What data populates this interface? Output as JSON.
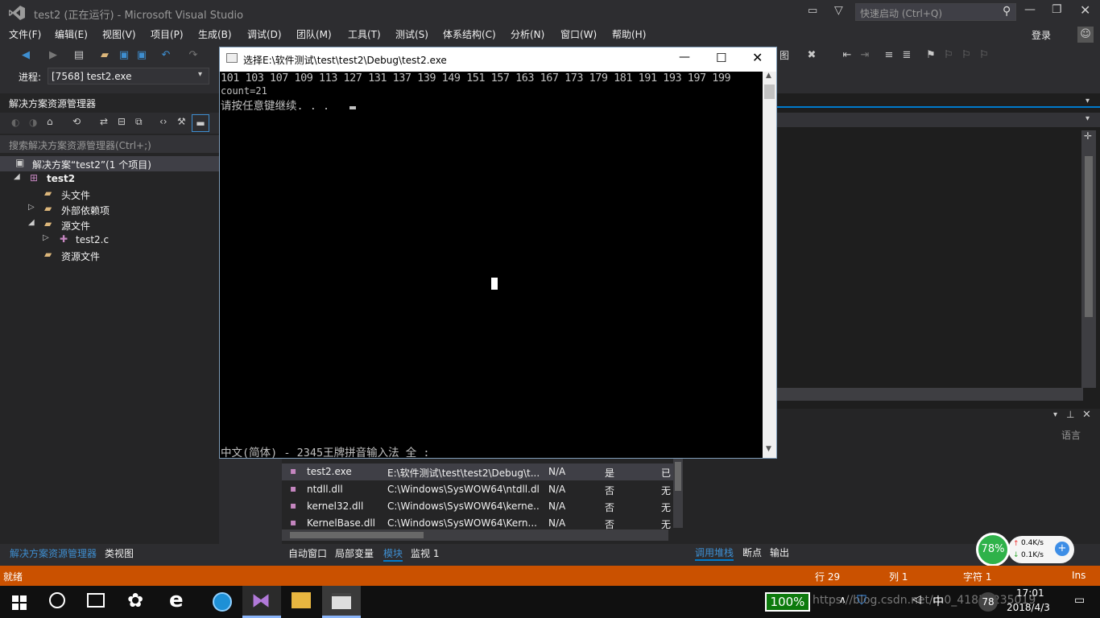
{
  "window": {
    "title": "test2 (正在运行) - Microsoft Visual Studio",
    "quick_launch_placeholder": "快速启动 (Ctrl+Q)",
    "login": "登录"
  },
  "menu": [
    "文件(F)",
    "编辑(E)",
    "视图(V)",
    "项目(P)",
    "生成(B)",
    "调试(D)",
    "团队(M)",
    "工具(T)",
    "测试(S)",
    "体系结构(C)",
    "分析(N)",
    "窗口(W)",
    "帮助(H)"
  ],
  "process": {
    "label": "进程:",
    "value": "[7568] test2.exe"
  },
  "solution_explorer": {
    "title": "解决方案资源管理器",
    "search_placeholder": "搜索解决方案资源管理器(Ctrl+;)",
    "solution": "解决方案“test2”(1 个项目)",
    "project": "test2",
    "items": [
      "头文件",
      "外部依赖项",
      "源文件",
      "test2.c",
      "资源文件"
    ]
  },
  "console": {
    "title": "选择E:\\软件测试\\test\\test2\\Debug\\test2.exe",
    "line1": "101 103 107 109 113 127 131 137 139 149 151 157 163 167 173 179 181 191 193 197 199",
    "line2": "count=21",
    "line3": "请按任意键继续. . .",
    "ime": "中文(简体) - 2345王牌拼音输入法 全 :"
  },
  "modules": {
    "rows": [
      {
        "name": "test2.exe",
        "path": "E:\\软件测试\\test\\test2\\Debug\\t...",
        "opt": "N/A",
        "user": "是",
        "status": "已"
      },
      {
        "name": "ntdll.dll",
        "path": "C:\\Windows\\SysWOW64\\ntdll.dll",
        "opt": "N/A",
        "user": "否",
        "status": "无"
      },
      {
        "name": "kernel32.dll",
        "path": "C:\\Windows\\SysWOW64\\kerne...",
        "opt": "N/A",
        "user": "否",
        "status": "无"
      },
      {
        "name": "KernelBase.dll",
        "path": "C:\\Windows\\SysWOW64\\Kern...",
        "opt": "N/A",
        "user": "否",
        "status": "无"
      }
    ],
    "tabs": [
      "自动窗口",
      "局部变量",
      "模块",
      "监视 1"
    ]
  },
  "left_tabs": [
    "解决方案资源管理器",
    "类视图"
  ],
  "right_tabs": [
    "调用堆栈",
    "断点",
    "输出"
  ],
  "callstack_header": "语言",
  "status": {
    "left": "就绪",
    "line": "行 29",
    "col": "列 1",
    "char": "字符 1",
    "mode": "Ins"
  },
  "widget": {
    "percent": "78%",
    "up": "0.4K/s",
    "down": "0.1K/s"
  },
  "tray": {
    "battery": "100%",
    "time": "17:01",
    "date": "2018/4/3",
    "watermark": "https://blog.csdn.net/m0_41839235019",
    "notif_count": "78"
  },
  "colors": {
    "vs_purple": "#68217a",
    "status_orange": "#ca5100",
    "accent_blue": "#007acc"
  }
}
